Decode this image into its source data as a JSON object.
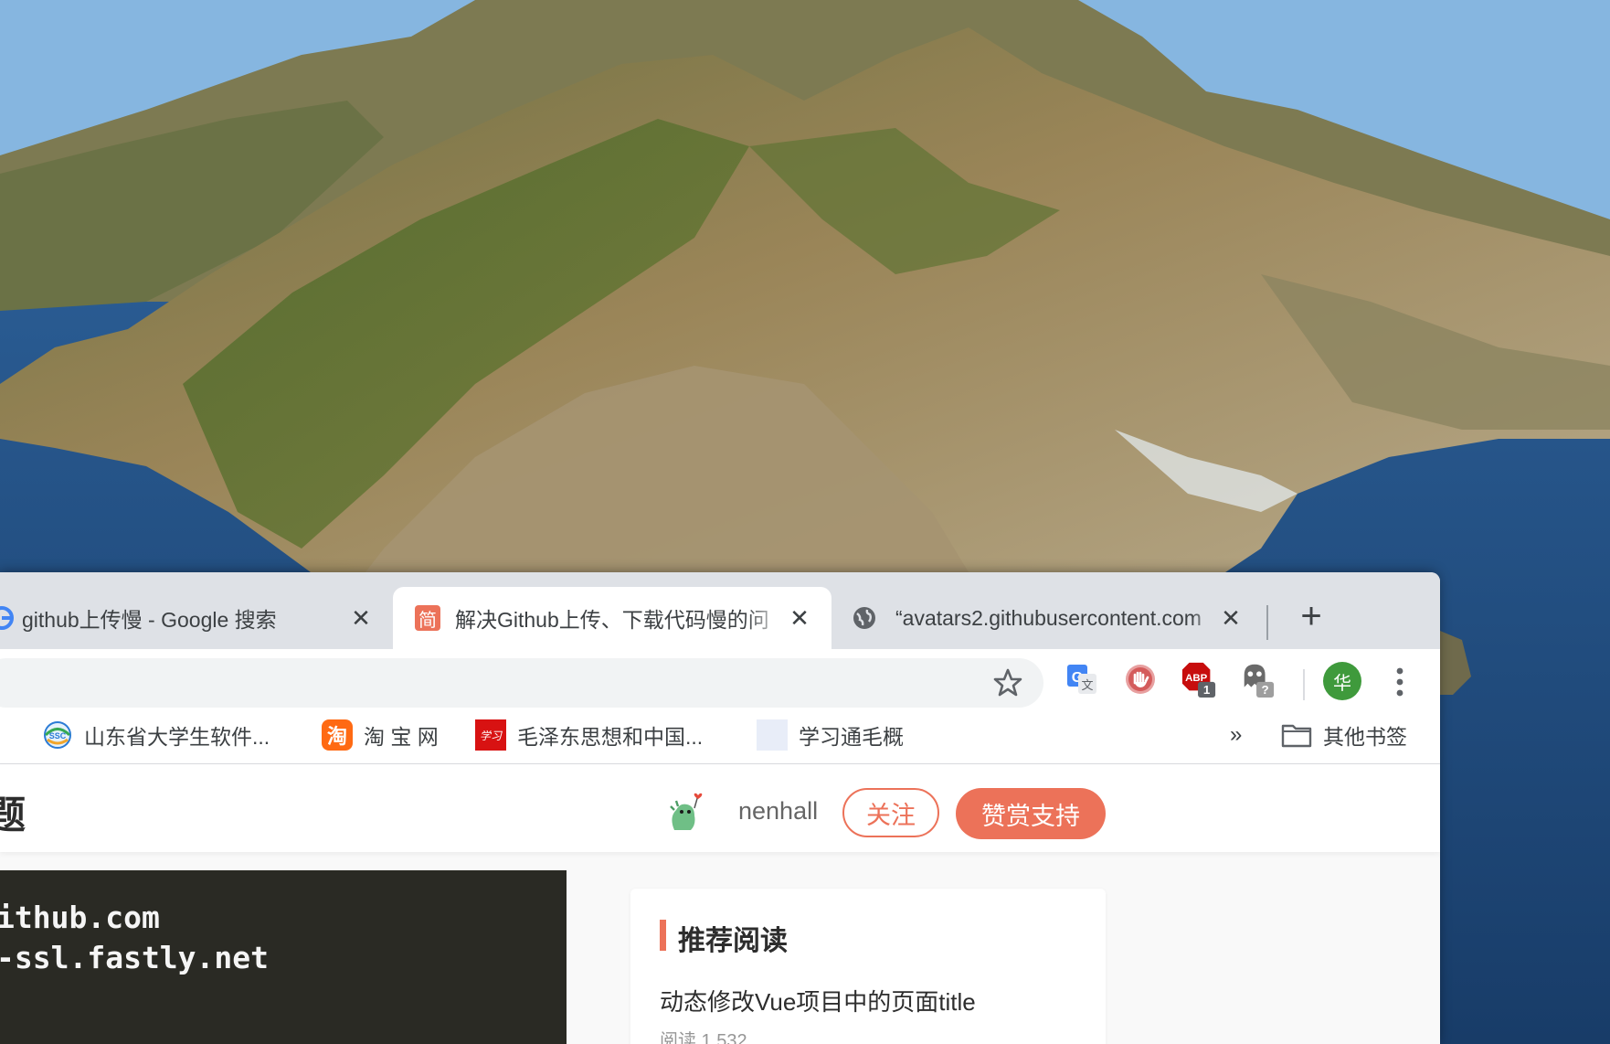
{
  "tabs": [
    {
      "title": "github上传慢 - Google 搜索",
      "icon": "google-icon",
      "active": false
    },
    {
      "title": "解决Github上传、下载代码慢的问",
      "icon": "jianshu-icon",
      "favicon_text": "简",
      "active": true
    },
    {
      "title": "“avatars2.githubusercontent.com",
      "icon": "globe-icon",
      "active": false
    }
  ],
  "toolbar": {
    "extensions": [
      "google-translate-icon",
      "adblock-hand-icon",
      "adblock-plus-icon",
      "ghostery-icon"
    ],
    "abp_badge": "1",
    "ghost_badge": "?",
    "profile_initial": "华"
  },
  "bookmarks": {
    "items": [
      {
        "label": "山东省大学生软件...",
        "icon": "sdu-icon",
        "icon_text": "SSC"
      },
      {
        "label": "淘 宝 网",
        "icon": "taobao-icon",
        "icon_text": "淘"
      },
      {
        "label": "毛泽东思想和中国...",
        "icon": "study-icon",
        "icon_text": "学习"
      },
      {
        "label": "学习通毛概",
        "icon": "blank-page-icon",
        "icon_text": ""
      }
    ],
    "more": "»",
    "other": "其他书签"
  },
  "article": {
    "title_fragment": "题",
    "author": "nenhall",
    "follow": "关注",
    "support": "赞赏支持",
    "code_lines": [
      "ithub.com",
      "-ssl.fastly.net"
    ]
  },
  "recommend": {
    "title": "推荐阅读",
    "items": [
      {
        "title": "动态修改Vue项目中的页面title",
        "meta": "阅读 1,532"
      }
    ]
  },
  "colors": {
    "accent": "#ec7259",
    "tabstrip": "#dee1e6",
    "code_bg": "#2a2a24"
  }
}
